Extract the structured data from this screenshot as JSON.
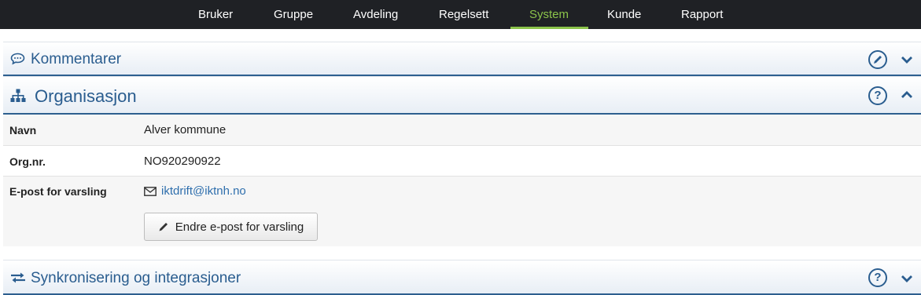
{
  "nav": {
    "items": [
      {
        "label": "Bruker"
      },
      {
        "label": "Gruppe"
      },
      {
        "label": "Avdeling"
      },
      {
        "label": "Regelsett"
      },
      {
        "label": "System"
      },
      {
        "label": "Kunde"
      },
      {
        "label": "Rapport"
      }
    ],
    "active": "System",
    "active_color": "#8bc34a"
  },
  "panels": {
    "comments": {
      "title": "Kommentarer",
      "icon": "comment-icon"
    },
    "organization": {
      "title": "Organisasjon",
      "icon": "sitemap-icon"
    },
    "sync": {
      "title": "Synkronisering og integrasjoner",
      "icon": "exchange-icon"
    }
  },
  "organization": {
    "rows": [
      {
        "label": "Navn",
        "value": "Alver kommune"
      },
      {
        "label": "Org.nr.",
        "value": "NO920290922"
      },
      {
        "label": "E-post for varsling",
        "value": "iktdrift@iktnh.no"
      }
    ],
    "change_email_button": "Endre e-post for varsling"
  },
  "colors": {
    "nav_bg": "#1f2125",
    "panel_title": "#2a5d8f",
    "link": "#2f6fad"
  }
}
